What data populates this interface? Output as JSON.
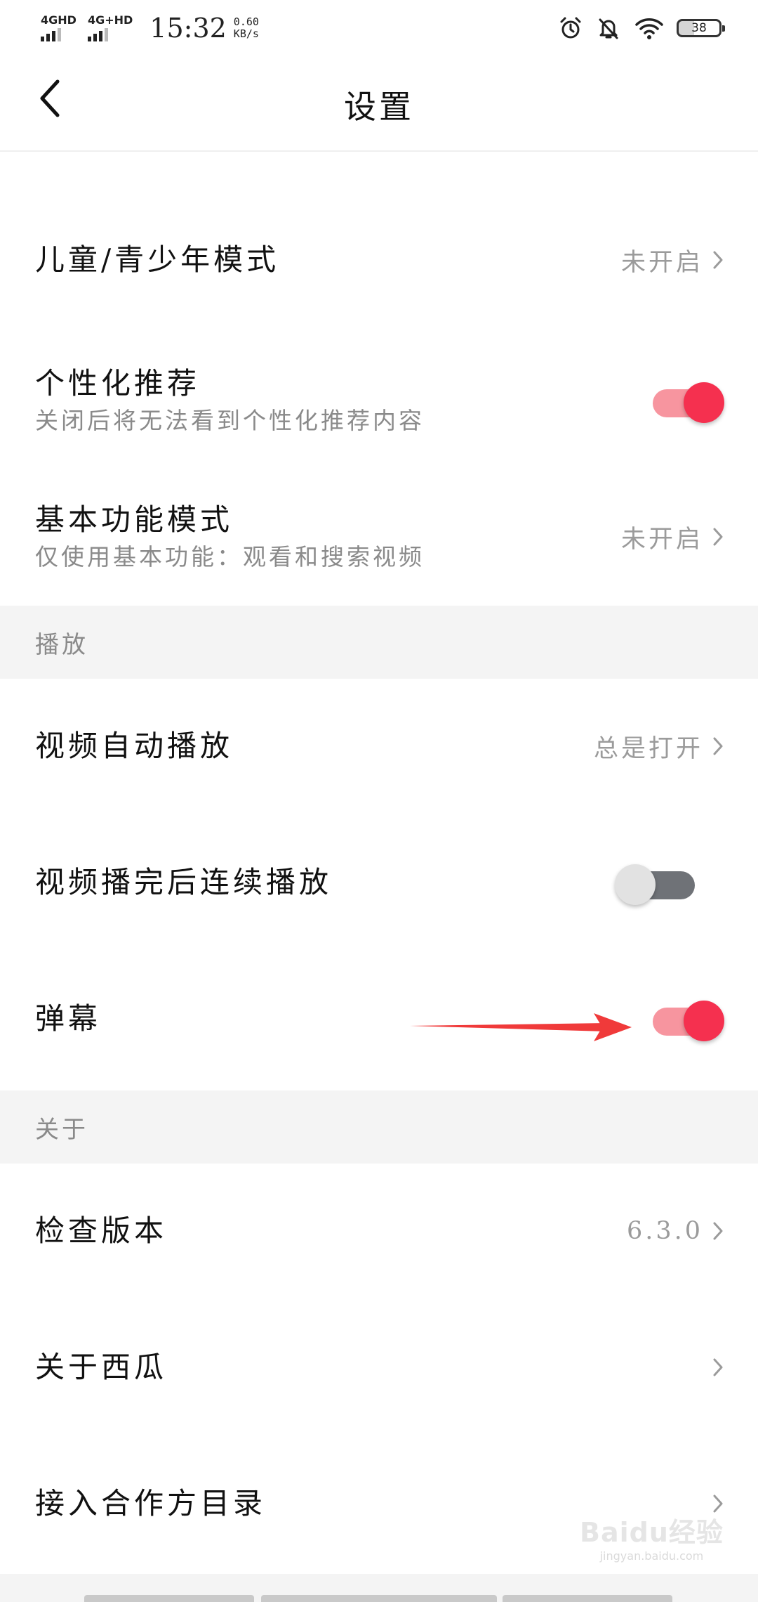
{
  "status_bar": {
    "signal_1": "4GHD",
    "signal_2": "4G+HD",
    "time": "15:32",
    "net_speed_value": "0.60",
    "net_speed_unit": "KB/s",
    "battery_level": "38",
    "icons": [
      "alarm-icon",
      "bell-off-icon",
      "wifi-icon",
      "battery-icon"
    ]
  },
  "header": {
    "title": "设置",
    "back_icon": "chevron-left-icon"
  },
  "settings": {
    "kids_mode": {
      "label": "儿童/青少年模式",
      "value": "未开启"
    },
    "personalized": {
      "label": "个性化推荐",
      "subtitle": "关闭后将无法看到个性化推荐内容",
      "enabled": true
    },
    "basic_mode": {
      "label": "基本功能模式",
      "subtitle": "仅使用基本功能：观看和搜索视频",
      "value": "未开启"
    }
  },
  "sections": {
    "playback": {
      "title": "播放",
      "autoplay": {
        "label": "视频自动播放",
        "value": "总是打开"
      },
      "continuous": {
        "label": "视频播完后连续播放",
        "enabled": false
      },
      "danmaku": {
        "label": "弹幕",
        "enabled": true
      }
    },
    "about": {
      "title": "关于",
      "check_version": {
        "label": "检查版本",
        "value": "6.3.0"
      },
      "about_app": {
        "label": "关于西瓜"
      },
      "partners": {
        "label": "接入合作方目录"
      }
    }
  },
  "watermark": {
    "logo_text": "Baidu经验",
    "url": "jingyan.baidu.com"
  },
  "colors": {
    "accent": "#f5304f",
    "accent_track": "#f7959f",
    "toggle_off_track": "#6f7277",
    "toggle_off_knob": "#e2e2e2",
    "section_bg": "#f4f4f4",
    "secondary_text": "#9b9b9b",
    "annotation_arrow": "#f03a3a"
  }
}
